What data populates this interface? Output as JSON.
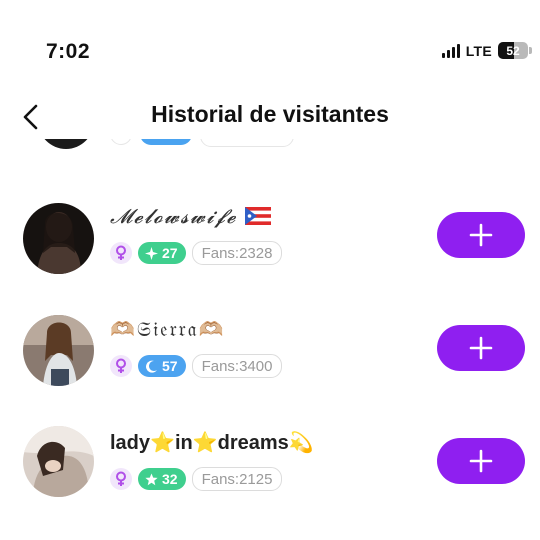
{
  "status_bar": {
    "time": "7:02",
    "network": "LTE",
    "battery": "52",
    "battery_level": 0.52
  },
  "header": {
    "title": "Historial de visitantes",
    "back_icon": "chevron-left-icon"
  },
  "visitors": [
    {
      "name": "𝓜𝓮𝓵𝓸𝔀𝓼𝔀𝓲𝓯𝓮",
      "name_emoji": "🇵🇷",
      "gender_icon": "female-icon",
      "level": "27",
      "level_icon": "sparkle-icon",
      "level_color": "#3fcf8e",
      "fans": "Fans:2328"
    },
    {
      "name_prefix": "🫶🏼",
      "name": "𝔖𝔦𝔢𝔯𝔯𝔞",
      "name_suffix": "🫶🏼",
      "gender_icon": "female-icon",
      "level": "57",
      "level_icon": "moon-icon",
      "level_color": "#4ca3f0",
      "fans": "Fans:3400"
    },
    {
      "name_parts": [
        "lady",
        "⭐",
        "in",
        "⭐",
        "dreams",
        "💫"
      ],
      "gender_icon": "female-icon",
      "level": "32",
      "level_icon": "star-icon",
      "level_color": "#3fcf8e",
      "fans": "Fans:2125"
    }
  ],
  "colors": {
    "follow_button": "#8f1ff0",
    "gender_bg": "#f1e6fb",
    "gender_fg": "#b04fe8"
  }
}
